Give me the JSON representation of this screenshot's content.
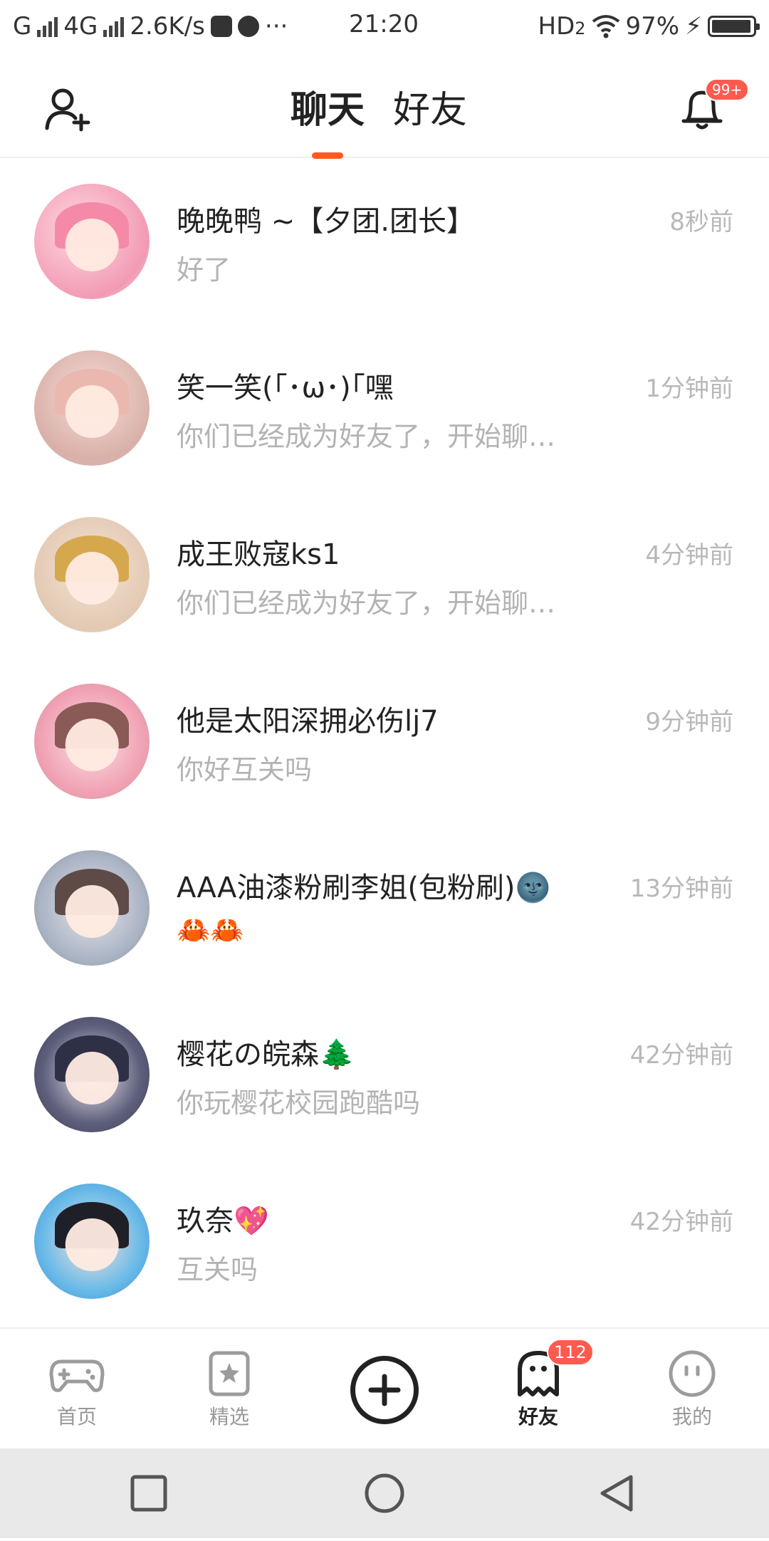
{
  "status_bar": {
    "carrier": "G",
    "network": "4G",
    "speed": "2.6K/s",
    "time": "21:20",
    "hd": "HD",
    "hd_sub": "2",
    "battery": "97%"
  },
  "header": {
    "tabs": [
      {
        "label": "聊天",
        "active": true
      },
      {
        "label": "好友",
        "active": false
      }
    ],
    "notification_badge": "99+"
  },
  "chats": [
    {
      "name": "晚晚鸭 ~【夕团.团长】",
      "preview": "好了",
      "time": "8秒前",
      "avatar_color": "#f7b6c8"
    },
    {
      "name": "笑一笑(｢･ω･)｢嘿",
      "preview": "你们已经成为好友了，开始聊…",
      "time": "1分钟前",
      "avatar_color": "#e9c9c3"
    },
    {
      "name": "成王败寇ks1",
      "preview": "你们已经成为好友了，开始聊…",
      "time": "4分钟前",
      "avatar_color": "#d8b47a"
    },
    {
      "name": "他是太阳深拥必伤lj7",
      "preview": "你好互关吗",
      "time": "9分钟前",
      "avatar_color": "#f0a7b4"
    },
    {
      "name": "AAA油漆粉刷李姐(包粉刷)🌚",
      "preview": "🦀🦀",
      "time": "13分钟前",
      "avatar_color": "#9aa6b5"
    },
    {
      "name": "樱花の皖森🌲",
      "preview": "你玩樱花校园跑酷吗",
      "time": "42分钟前",
      "avatar_color": "#4b4f6b"
    },
    {
      "name": "玖奈💖",
      "preview": "互关吗",
      "time": "42分钟前",
      "avatar_color": "#5fb3e6"
    }
  ],
  "bottom_nav": {
    "items": [
      {
        "label": "首页",
        "icon": "gamepad-icon"
      },
      {
        "label": "精选",
        "icon": "star-bookmark-icon"
      },
      {
        "label": "好友",
        "icon": "ghost-icon",
        "badge": "112",
        "active": true
      },
      {
        "label": "我的",
        "icon": "face-icon"
      }
    ]
  },
  "colors": {
    "accent": "#ff5a1f",
    "badge": "#ff5a4e",
    "muted_text": "#b3b3b3"
  }
}
